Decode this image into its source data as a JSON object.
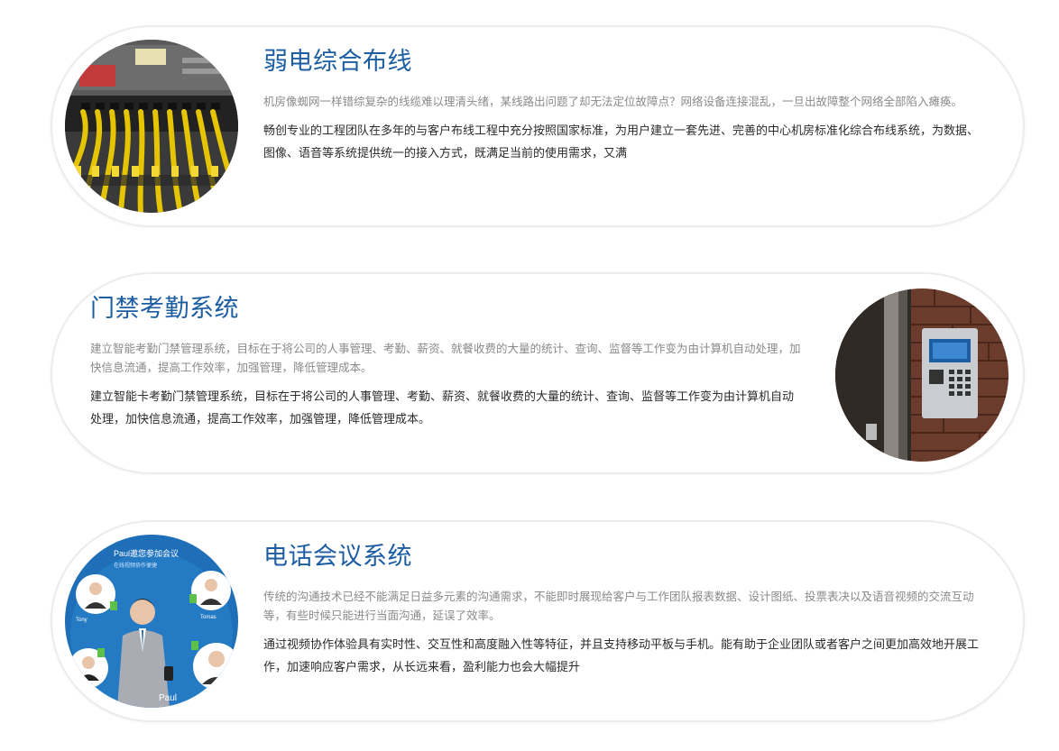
{
  "services": [
    {
      "title": "弱电综合布线",
      "description": "机房像蜘网一样错综复杂的线缆难以理清头绪，某线路出问题了却无法定位故障点？网络设备连接混乱，一旦出故障整个网络全部陷入瘫痪。",
      "detail": "畅创专业的工程团队在多年的与客户布线工程中充分按照国家标准，为用户建立一套先进、完善的中心机房标准化综合布线系统，为数据、图像、语音等系统提供统一的接入方式，既满足当前的使用需求，又满",
      "image_icon": "network-patch-panel-photo"
    },
    {
      "title": "门禁考勤系统",
      "description": "建立智能考勤门禁管理系统，目标在于将公司的人事管理、考勤、薪资、就餐收费的大量的统计、查询、监督等工作变为由计算机自动处理，加 快信息流通，提高工作效率，加强管理，降低管理成本。",
      "detail": "建立智能卡考勤门禁管理系统，目标在于将公司的人事管理、考勤、薪资、就餐收费的大量的统计、查询、监督等工作变为由计算机自动处理，加快信息流通，提高工作效率，加强管理，降低管理成本。",
      "image_icon": "door-access-panel-photo"
    },
    {
      "title": "电话会议系统",
      "description": "传统的沟通技术已经不能满足日益多元素的沟通需求，不能即时展现给客户与工作团队报表数据、设计图纸、投票表决以及语音视频的交流互动 等，有些时候只能进行当面沟通，延误了效率。",
      "detail": "通过视频协作体验具有实时性、交互性和高度融入性等特征，并且支持移动平板与手机。能有助于企业团队或者客户之间更加高效地开展工作，加速响应客户需求，从长远来看，盈利能力也会大幅提升",
      "image_icon": "video-conference-photo",
      "image_caption_top": "Paul邀您参加会议",
      "image_caption_sub": "在线视频协作便捷",
      "image_names": [
        "Tony",
        "Tomas",
        "Paul"
      ]
    }
  ],
  "colors": {
    "title": "#1d5ea3",
    "description": "#8a8a8a",
    "detail": "#2b2b2b",
    "card_border": "#ececec"
  }
}
